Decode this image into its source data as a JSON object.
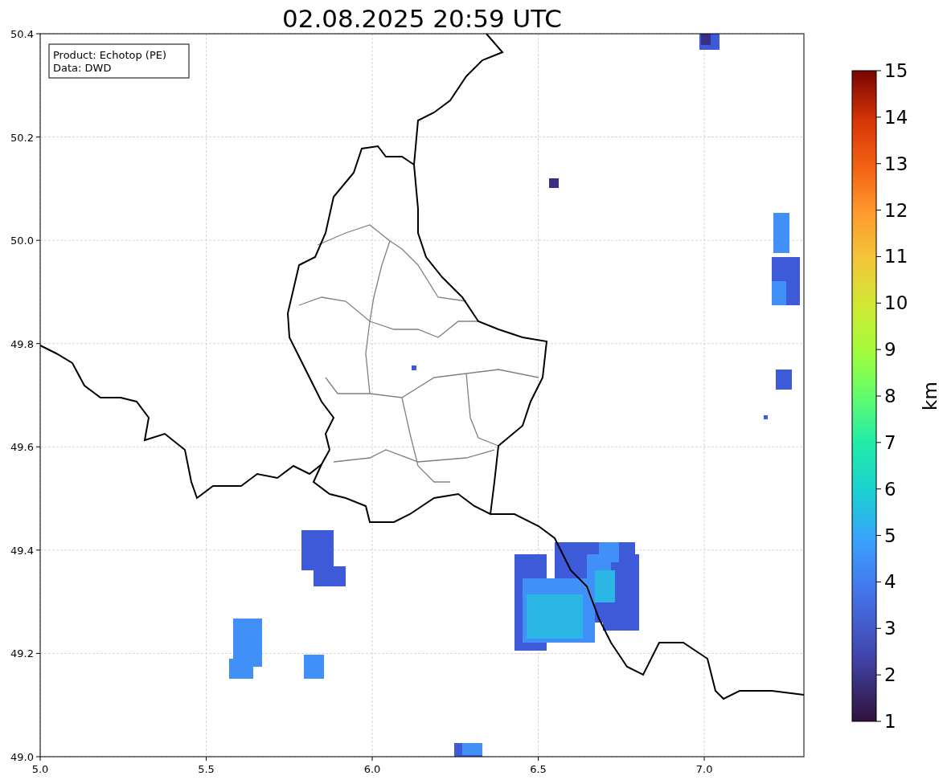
{
  "title": "02.08.2025 20:59 UTC",
  "info_box": [
    "Product: Echotop (PE)",
    "Data: DWD"
  ],
  "map": {
    "x_ticks": [
      "5.0",
      "5.5",
      "6.0",
      "6.5",
      "7.0"
    ],
    "y_ticks": [
      "50.4",
      "50.2",
      "50.0",
      "49.8",
      "49.6",
      "49.4",
      "49.2",
      "49.0"
    ]
  },
  "colorbar": {
    "label": "km",
    "ticks": [
      "15",
      "14",
      "13",
      "12",
      "11",
      "10",
      "9",
      "8",
      "7",
      "6",
      "5",
      "4",
      "3",
      "2",
      "1"
    ]
  }
}
